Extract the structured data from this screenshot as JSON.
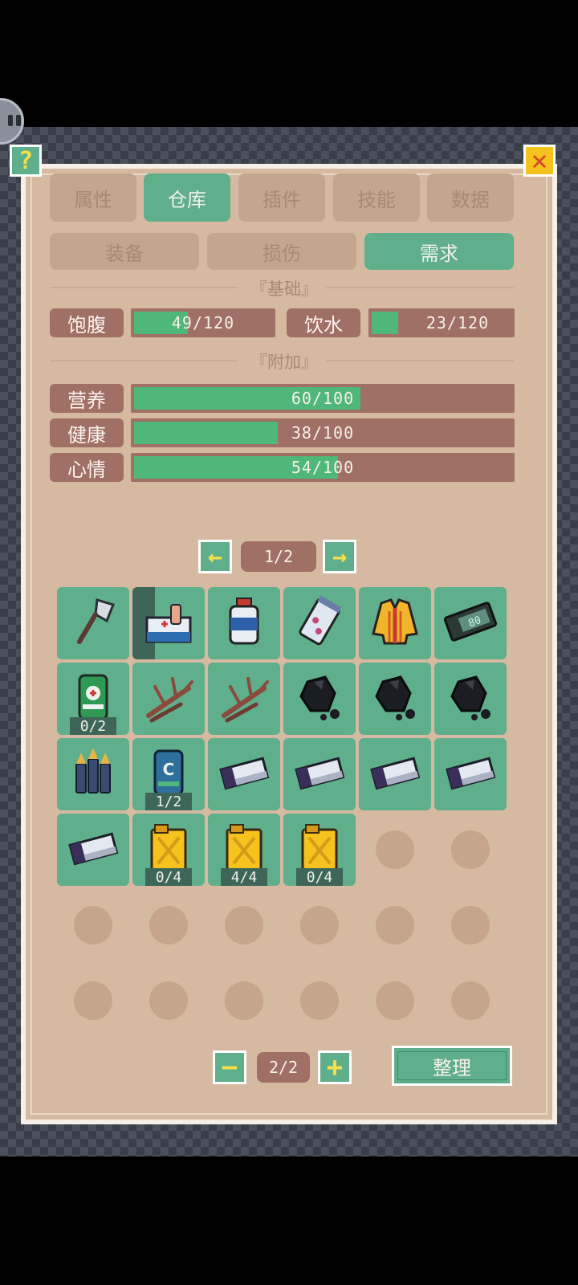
{
  "tabs": [
    {
      "label": "属性",
      "active": false
    },
    {
      "label": "仓库",
      "active": true
    },
    {
      "label": "插件",
      "active": false
    },
    {
      "label": "技能",
      "active": false
    },
    {
      "label": "数据",
      "active": false
    }
  ],
  "subtabs": [
    {
      "label": "装备",
      "active": false
    },
    {
      "label": "损伤",
      "active": false
    },
    {
      "label": "需求",
      "active": true
    }
  ],
  "help_label": "?",
  "close_label": "✕",
  "basic": {
    "title": "『基础』",
    "satiety": {
      "label": "饱腹",
      "value": 49,
      "max": 120,
      "text": "49/120"
    },
    "water": {
      "label": "饮水",
      "value": 23,
      "max": 120,
      "text": "23/120"
    }
  },
  "extra": {
    "title": "『附加』",
    "stats": [
      {
        "label": "营养",
        "value": 60,
        "max": 100,
        "text": "60/100"
      },
      {
        "label": "健康",
        "value": 38,
        "max": 100,
        "text": "38/100"
      },
      {
        "label": "心情",
        "value": 54,
        "max": 100,
        "text": "54/100"
      }
    ]
  },
  "pager": {
    "text": "1/2",
    "prev_icon": "arrow-left-icon",
    "next_icon": "arrow-right-icon"
  },
  "inventory": [
    {
      "icon": "axe-icon",
      "count": ""
    },
    {
      "icon": "first-aid-kit-icon",
      "count": "",
      "selected": true
    },
    {
      "icon": "pill-bottle-icon",
      "count": ""
    },
    {
      "icon": "medicine-jar-icon",
      "count": ""
    },
    {
      "icon": "jacket-icon",
      "count": ""
    },
    {
      "icon": "digital-device-icon",
      "count": ""
    },
    {
      "icon": "beer-can-icon",
      "count": "0/2"
    },
    {
      "icon": "branches-icon",
      "count": ""
    },
    {
      "icon": "branches-icon",
      "count": ""
    },
    {
      "icon": "coal-icon",
      "count": ""
    },
    {
      "icon": "coal-icon",
      "count": ""
    },
    {
      "icon": "coal-icon",
      "count": ""
    },
    {
      "icon": "bullets-icon",
      "count": ""
    },
    {
      "icon": "soda-can-icon",
      "count": "1/2"
    },
    {
      "icon": "battery-icon",
      "count": ""
    },
    {
      "icon": "battery-icon",
      "count": ""
    },
    {
      "icon": "battery-icon",
      "count": ""
    },
    {
      "icon": "battery-icon",
      "count": ""
    },
    {
      "icon": "battery-icon",
      "count": ""
    },
    {
      "icon": "jerry-can-icon",
      "count": "0/4"
    },
    {
      "icon": "jerry-can-icon",
      "count": "4/4"
    },
    {
      "icon": "jerry-can-icon",
      "count": "0/4"
    }
  ],
  "capacity": {
    "text": "2/2",
    "minus_icon": "minus-icon",
    "plus_icon": "plus-icon"
  },
  "sort_label": "整理"
}
